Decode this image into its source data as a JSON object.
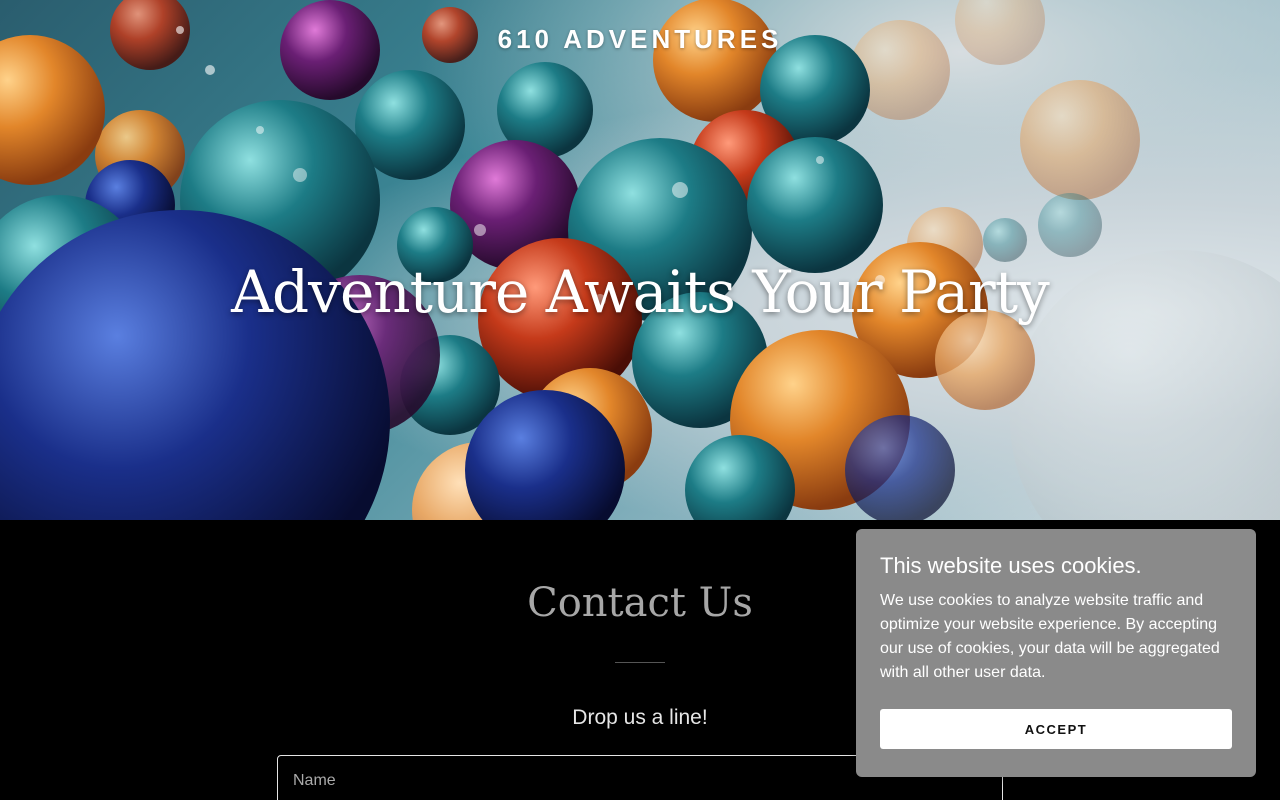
{
  "hero": {
    "brand": "610 ADVENTURES",
    "title": "Adventure Awaits Your Party"
  },
  "contact": {
    "title": "Contact Us",
    "subtitle": "Drop us a line!",
    "name_placeholder": "Name"
  },
  "cookie_banner": {
    "title": "This website uses cookies.",
    "text": "We use cookies to analyze website traffic and optimize your website experience. By accepting our use of cookies, your data will be aggregated with all other user data.",
    "accept_label": "ACCEPT"
  },
  "colors": {
    "page_background": "#000000",
    "cookie_background": "#8a8a8a",
    "contact_title": "#a7a7a7"
  }
}
